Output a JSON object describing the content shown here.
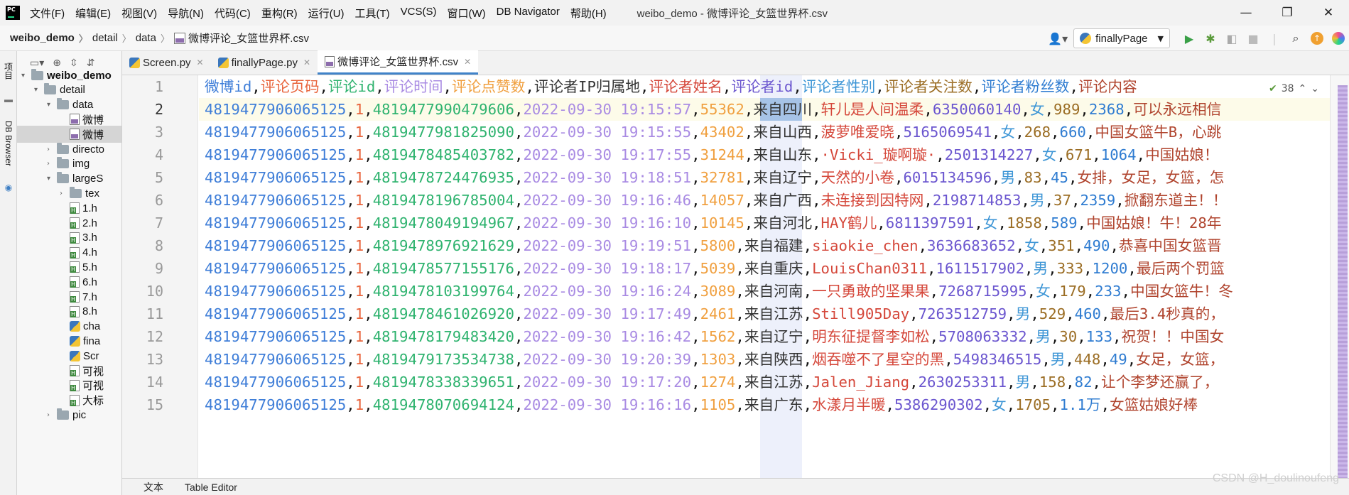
{
  "menubar": {
    "items": [
      "文件(F)",
      "编辑(E)",
      "视图(V)",
      "导航(N)",
      "代码(C)",
      "重构(R)",
      "运行(U)",
      "工具(T)",
      "VCS(S)",
      "窗口(W)",
      "DB Navigator",
      "帮助(H)"
    ],
    "window_title": "weibo_demo - 微博评论_女篮世界杯.csv"
  },
  "breadcrumb": [
    "weibo_demo",
    "detail",
    "data",
    "微博评论_女篮世界杯.csv"
  ],
  "run_config": "finallyPage",
  "side_tabs": [
    "项目",
    "DB Browser"
  ],
  "project_tree": [
    {
      "label": "weibo_demo",
      "kind": "folder",
      "arrow": "▾",
      "depth": 0
    },
    {
      "label": "detail",
      "kind": "folder",
      "arrow": "▾",
      "depth": 1
    },
    {
      "label": "data",
      "kind": "folder",
      "arrow": "▾",
      "depth": 2
    },
    {
      "label": "微博",
      "kind": "csv",
      "arrow": "",
      "depth": 3
    },
    {
      "label": "微博",
      "kind": "csv",
      "arrow": "",
      "depth": 3,
      "selected": true
    },
    {
      "label": "directo",
      "kind": "folder",
      "arrow": "›",
      "depth": 2
    },
    {
      "label": "img",
      "kind": "folder",
      "arrow": "›",
      "depth": 2
    },
    {
      "label": "largeS",
      "kind": "folder",
      "arrow": "▾",
      "depth": 2
    },
    {
      "label": "tex",
      "kind": "folder",
      "arrow": "›",
      "depth": 3
    },
    {
      "label": "1.h",
      "kind": "html",
      "arrow": "",
      "depth": 3
    },
    {
      "label": "2.h",
      "kind": "html",
      "arrow": "",
      "depth": 3
    },
    {
      "label": "3.h",
      "kind": "html",
      "arrow": "",
      "depth": 3
    },
    {
      "label": "4.h",
      "kind": "html",
      "arrow": "",
      "depth": 3
    },
    {
      "label": "5.h",
      "kind": "html",
      "arrow": "",
      "depth": 3
    },
    {
      "label": "6.h",
      "kind": "html",
      "arrow": "",
      "depth": 3
    },
    {
      "label": "7.h",
      "kind": "html",
      "arrow": "",
      "depth": 3
    },
    {
      "label": "8.h",
      "kind": "html",
      "arrow": "",
      "depth": 3
    },
    {
      "label": "cha",
      "kind": "py",
      "arrow": "",
      "depth": 3
    },
    {
      "label": "fina",
      "kind": "py",
      "arrow": "",
      "depth": 3
    },
    {
      "label": "Scr",
      "kind": "py",
      "arrow": "",
      "depth": 3
    },
    {
      "label": "可视",
      "kind": "html",
      "arrow": "",
      "depth": 3
    },
    {
      "label": "可视",
      "kind": "html",
      "arrow": "",
      "depth": 3
    },
    {
      "label": "大标",
      "kind": "html",
      "arrow": "",
      "depth": 3
    },
    {
      "label": "pic",
      "kind": "folder",
      "arrow": "›",
      "depth": 2
    }
  ],
  "editor_tabs": [
    {
      "label": "Screen.py",
      "kind": "py",
      "active": false
    },
    {
      "label": "finallyPage.py",
      "kind": "py",
      "active": false
    },
    {
      "label": "微博评论_女篮世界杯.csv",
      "kind": "csv",
      "active": true
    }
  ],
  "inspection": {
    "count": "38"
  },
  "colors": [
    "#3f7ed8",
    "#e8643c",
    "#2fb36f",
    "#a98be3",
    "#f0a040",
    "#333333",
    "#d5483b",
    "#6b56cf",
    "#3e96d6",
    "#9b6d24",
    "#2f7cd1",
    "#b0442e"
  ],
  "csv": {
    "header": [
      "微博id",
      "评论页码",
      "评论id",
      "评论时间",
      "评论点赞数",
      "评论者IP归属地",
      "评论者姓名",
      "评论者id",
      "评论者性别",
      "评论者关注数",
      "评论者粉丝数",
      "评论内容"
    ],
    "rows": [
      [
        "4819477906065125",
        "1",
        "4819477990479606",
        "2022-09-30 19:15:57",
        "55362",
        "来自四川",
        "轩儿是人间温柔",
        "6350060140",
        "女",
        "989",
        "2368",
        "可以永远相信"
      ],
      [
        "4819477906065125",
        "1",
        "4819477981825090",
        "2022-09-30 19:15:55",
        "43402",
        "来自山西",
        "菠萝唯爱晓",
        "5165069541",
        "女",
        "268",
        "660",
        "中国女篮牛B，心跳"
      ],
      [
        "4819477906065125",
        "1",
        "4819478485403782",
        "2022-09-30 19:17:55",
        "31244",
        "来自山东",
        "·Vicki_璇啊璇·",
        "2501314227",
        "女",
        "671",
        "1064",
        "中国姑娘！"
      ],
      [
        "4819477906065125",
        "1",
        "4819478724476935",
        "2022-09-30 19:18:51",
        "32781",
        "来自辽宁",
        "天然的小卷",
        "6015134596",
        "男",
        "83",
        "45",
        "女排，女足，女篮，怎"
      ],
      [
        "4819477906065125",
        "1",
        "4819478196785004",
        "2022-09-30 19:16:46",
        "14057",
        "来自广西",
        "未连接到因特网",
        "2198714853",
        "男",
        "37",
        "2359",
        "掀翻东道主！！"
      ],
      [
        "4819477906065125",
        "1",
        "4819478049194967",
        "2022-09-30 19:16:10",
        "10145",
        "来自河北",
        "HAY鹤儿",
        "6811397591",
        "女",
        "1858",
        "589",
        "中国姑娘！牛！28年"
      ],
      [
        "4819477906065125",
        "1",
        "4819478976921629",
        "2022-09-30 19:19:51",
        "5800",
        "来自福建",
        "siaokie_chen",
        "3636683652",
        "女",
        "351",
        "490",
        "恭喜中国女篮晋"
      ],
      [
        "4819477906065125",
        "1",
        "4819478577155176",
        "2022-09-30 19:18:17",
        "5039",
        "来自重庆",
        "LouisChan0311",
        "1611517902",
        "男",
        "333",
        "1200",
        "最后两个罚篮"
      ],
      [
        "4819477906065125",
        "1",
        "4819478103199764",
        "2022-09-30 19:16:24",
        "3089",
        "来自河南",
        "一只勇敢的坚果果",
        "7268715995",
        "女",
        "179",
        "233",
        "中国女篮牛！冬"
      ],
      [
        "4819477906065125",
        "1",
        "4819478461026920",
        "2022-09-30 19:17:49",
        "2461",
        "来自江苏",
        "Still905Day",
        "7263512759",
        "男",
        "529",
        "460",
        "最后3.4秒真的，"
      ],
      [
        "4819477906065125",
        "1",
        "4819478179483420",
        "2022-09-30 19:16:42",
        "1562",
        "来自辽宁",
        "明东征提督李如松",
        "5708063332",
        "男",
        "30",
        "133",
        "祝贺！！中国女"
      ],
      [
        "4819477906065125",
        "1",
        "4819479173534738",
        "2022-09-30 19:20:39",
        "1303",
        "来自陕西",
        "烟吞噬不了星空的黑",
        "5498346515",
        "男",
        "448",
        "49",
        "女足，女篮，"
      ],
      [
        "4819477906065125",
        "1",
        "4819478338339651",
        "2022-09-30 19:17:20",
        "1274",
        "来自江苏",
        "Jalen_Jiang",
        "2630253311",
        "男",
        "158",
        "82",
        "让个李梦还赢了，"
      ],
      [
        "4819477906065125",
        "1",
        "4819478070694124",
        "2022-09-30 19:16:16",
        "1105",
        "来自广东",
        "水漾月半暖",
        "5386290302",
        "女",
        "1705",
        "1.1万",
        "女篮姑娘好棒"
      ]
    ]
  },
  "bottom_tabs": [
    "文本",
    "Table Editor"
  ],
  "watermark": "CSDN @H_doulinoufeng"
}
